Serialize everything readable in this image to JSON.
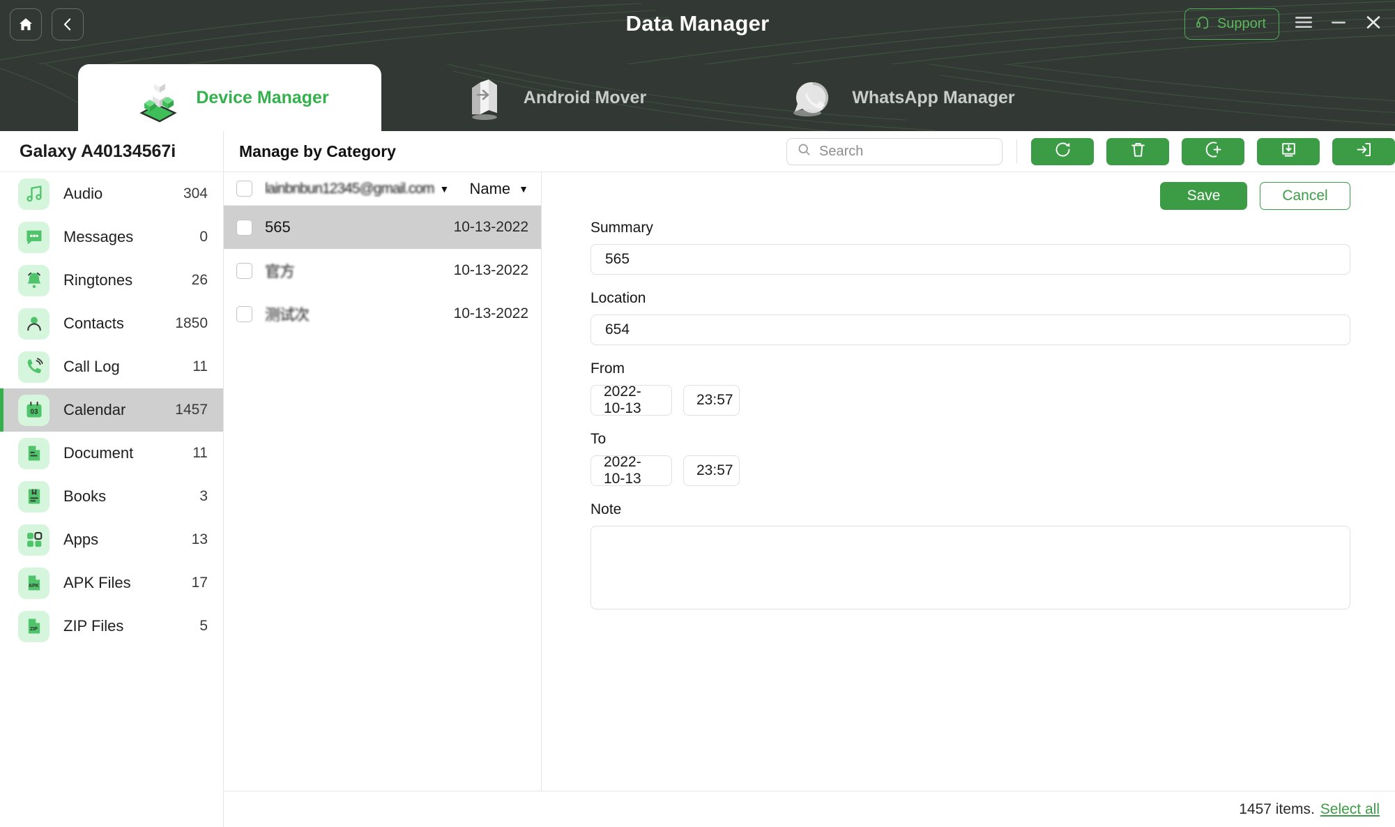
{
  "window": {
    "title": "Data Manager",
    "home_icon": "home-icon",
    "back_icon": "chevron-left-icon",
    "support_label": "Support",
    "support_icon": "headset-icon",
    "menu_icon": "hamburger-menu-icon",
    "minimize_icon": "minimize-icon",
    "close_icon": "close-icon",
    "accent_green": "#34b14c",
    "titlebar_bg": "#323833"
  },
  "tabs": [
    {
      "label": "Device Manager",
      "icon": "device-manager-icon",
      "active": true
    },
    {
      "label": "Android Mover",
      "icon": "android-mover-icon",
      "active": false
    },
    {
      "label": "WhatsApp Manager",
      "icon": "whatsapp-manager-icon",
      "active": false
    }
  ],
  "sidebar": {
    "device_name": "Galaxy A40134567i",
    "items": [
      {
        "label": "Audio",
        "count": "304",
        "icon": "music-note-icon",
        "selected": false
      },
      {
        "label": "Messages",
        "count": "0",
        "icon": "chat-bubble-icon",
        "selected": false
      },
      {
        "label": "Ringtones",
        "count": "26",
        "icon": "bell-icon",
        "selected": false
      },
      {
        "label": "Contacts",
        "count": "1850",
        "icon": "person-icon",
        "selected": false
      },
      {
        "label": "Call Log",
        "count": "11",
        "icon": "phone-icon",
        "selected": false
      },
      {
        "label": "Calendar",
        "count": "1457",
        "icon": "calendar-icon",
        "selected": true
      },
      {
        "label": "Document",
        "count": "11",
        "icon": "document-icon",
        "selected": false
      },
      {
        "label": "Books",
        "count": "3",
        "icon": "book-icon",
        "selected": false
      },
      {
        "label": "Apps",
        "count": "13",
        "icon": "apps-grid-icon",
        "selected": false
      },
      {
        "label": "APK Files",
        "count": "17",
        "icon": "apk-file-icon",
        "selected": false
      },
      {
        "label": "ZIP Files",
        "count": "5",
        "icon": "zip-file-icon",
        "selected": false
      }
    ]
  },
  "toolbar": {
    "title": "Manage by Category",
    "search_placeholder": "Search",
    "search_value": "",
    "search_icon": "search-icon",
    "actions": [
      {
        "name": "refresh-button",
        "icon": "refresh-icon"
      },
      {
        "name": "delete-button",
        "icon": "trash-icon"
      },
      {
        "name": "add-button",
        "icon": "circle-plus-icon"
      },
      {
        "name": "export-button",
        "icon": "download-box-icon"
      },
      {
        "name": "import-button",
        "icon": "import-arrow-icon"
      }
    ]
  },
  "list": {
    "account": "lainbnbun12345@gmail.com",
    "account_caret": "▼",
    "sort_label": "Name",
    "sort_caret": "▼",
    "rows": [
      {
        "name": "565",
        "date": "10-13-2022",
        "selected": true,
        "redacted": false
      },
      {
        "name": "官方",
        "date": "10-13-2022",
        "selected": false,
        "redacted": true
      },
      {
        "name": "测试次",
        "date": "10-13-2022",
        "selected": false,
        "redacted": true
      }
    ]
  },
  "detail": {
    "save_label": "Save",
    "cancel_label": "Cancel",
    "summary_label": "Summary",
    "summary_value": "565",
    "location_label": "Location",
    "location_value": "654",
    "from_label": "From",
    "from_date": "2022-10-13",
    "from_time": "23:57",
    "to_label": "To",
    "to_date": "2022-10-13",
    "to_time": "23:57",
    "note_label": "Note",
    "note_value": ""
  },
  "statusbar": {
    "count_text": "1457 items.",
    "select_all_label": "Select all"
  }
}
